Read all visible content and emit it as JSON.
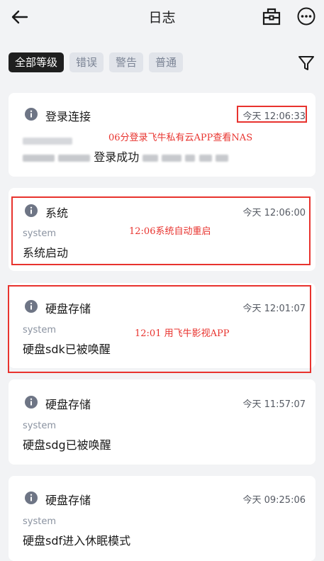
{
  "header": {
    "title": "日志",
    "back_icon": "arrow-left-icon",
    "toolbox_icon": "toolbox-icon",
    "more_icon": "more-circle-icon"
  },
  "filters": {
    "chips": [
      {
        "label": "全部等级",
        "active": true
      },
      {
        "label": "错误",
        "active": false
      },
      {
        "label": "警告",
        "active": false
      },
      {
        "label": "普通",
        "active": false
      }
    ],
    "filter_icon": "funnel-icon"
  },
  "logs": [
    {
      "category": "登录连接",
      "time": "今天 12:06:33",
      "source": "",
      "message": "登录成功",
      "icon": "info-icon"
    },
    {
      "category": "系统",
      "time": "今天 12:06:00",
      "source": "system",
      "message": "系统启动",
      "icon": "info-icon"
    },
    {
      "category": "硬盘存储",
      "time": "今天 12:01:07",
      "source": "system",
      "message": "硬盘sdk已被唤醒",
      "icon": "info-icon"
    },
    {
      "category": "硬盘存储",
      "time": "今天 11:57:07",
      "source": "system",
      "message": "硬盘sdg已被唤醒",
      "icon": "info-icon"
    },
    {
      "category": "硬盘存储",
      "time": "今天 09:25:06",
      "source": "system",
      "message": "硬盘sdf进入休眠模式",
      "icon": "info-icon"
    }
  ],
  "annotations": [
    {
      "text": "06分登录飞牛私有云APP查看NAS"
    },
    {
      "text": "12:06系统自动重启"
    },
    {
      "text": "12:01 用飞牛影视APP"
    }
  ],
  "colors": {
    "background": "#f2f3f5",
    "card": "#ffffff",
    "chip_active": "#1f1f1f",
    "chip_inactive": "#e1e4ea",
    "annotation_red": "#e8332e",
    "info_icon": "#6e7585"
  }
}
